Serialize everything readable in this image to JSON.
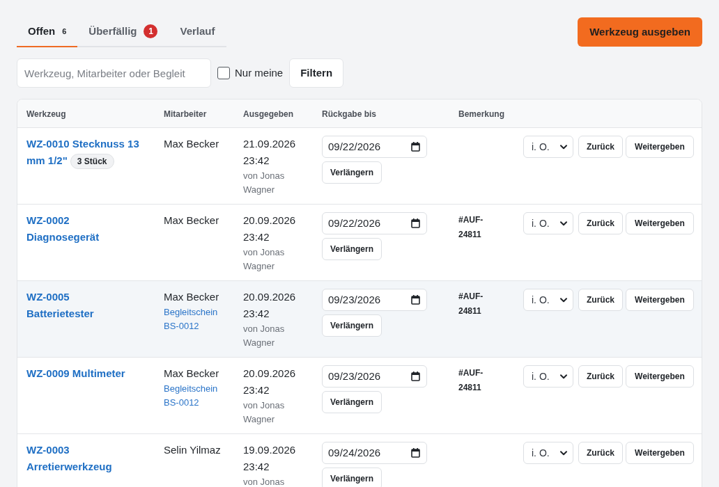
{
  "tabs": [
    {
      "label": "Offen",
      "count": {
        "text": "6",
        "kind": "plain"
      },
      "selected": true
    },
    {
      "label": "Überfällig",
      "count": {
        "text": "1",
        "kind": "alert"
      },
      "selected": false
    },
    {
      "label": "Verlauf",
      "selected": false
    }
  ],
  "primary_button": "Werkzeug ausgeben",
  "filters": {
    "search": {
      "placeholder": "Werkzeug, Mitarbeiter oder Begleit"
    },
    "only_mine": {
      "label": "Nur meine",
      "checked": false
    },
    "button": "Filtern"
  },
  "table": {
    "columns": [
      "Werkzeug",
      "Mitarbeiter",
      "Ausgegeben",
      "Rückgabe bis",
      "Bemerkung"
    ],
    "rows": [
      {
        "tool": "WZ-0010 Stecknuss 13 mm 1/2\"",
        "quantity": "3 Stück",
        "employee": "Max Becker",
        "issued": "21.09.2026 23:42",
        "issued_by": "von Jonas Wagner",
        "due_date": "09/22/2026",
        "extend_button": "Verlängern",
        "condition": "i. O.",
        "return_button": "Zurück",
        "pass_button": "Weitergeben",
        "highlighted": false
      },
      {
        "tool": "WZ-0002 Diagnosegerät",
        "employee": "Max Becker",
        "issued": "20.09.2026 23:42",
        "issued_by": "von Jonas Wagner",
        "due_date": "09/22/2026",
        "extend_button": "Verlängern",
        "remark": "#AUF-24811",
        "condition": "i. O.",
        "return_button": "Zurück",
        "pass_button": "Weitergeben",
        "highlighted": false
      },
      {
        "tool": "WZ-0005 Batterietester",
        "employee": "Max Becker",
        "document": "Begleitschein BS-0012",
        "issued": "20.09.2026 23:42",
        "issued_by": "von Jonas Wagner",
        "due_date": "09/23/2026",
        "extend_button": "Verlängern",
        "remark": "#AUF-24811",
        "condition": "i. O.",
        "return_button": "Zurück",
        "pass_button": "Weitergeben",
        "highlighted": true
      },
      {
        "tool": "WZ-0009 Multimeter",
        "employee": "Max Becker",
        "document": "Begleitschein BS-0012",
        "issued": "20.09.2026 23:42",
        "issued_by": "von Jonas Wagner",
        "due_date": "09/23/2026",
        "extend_button": "Verlängern",
        "remark": "#AUF-24811",
        "condition": "i. O.",
        "return_button": "Zurück",
        "pass_button": "Weitergeben",
        "highlighted": false
      },
      {
        "tool": "WZ-0003 Arretierwerkzeug",
        "employee": "Selin Yilmaz",
        "issued": "19.09.2026 23:42",
        "issued_by": "von Jonas",
        "due_date": "09/24/2026",
        "extend_button": "Verlängern",
        "condition": "i. O.",
        "return_button": "Zurück",
        "pass_button": "Weitergeben",
        "highlighted": false
      }
    ]
  }
}
